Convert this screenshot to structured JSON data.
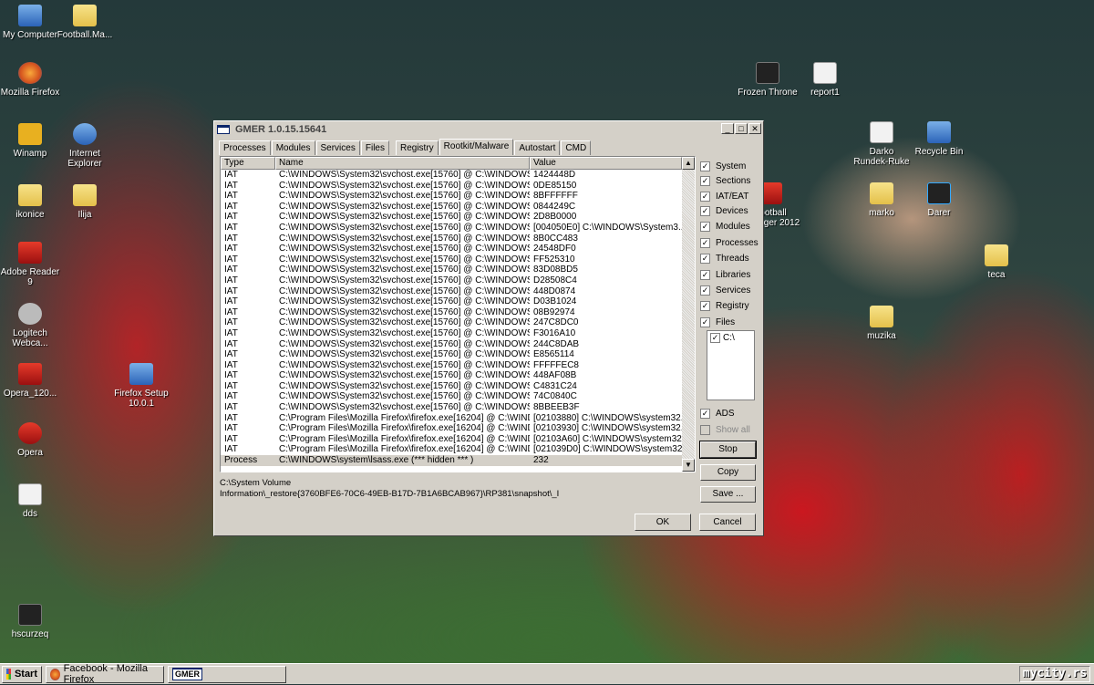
{
  "desktop": {
    "icons": [
      {
        "label": "My Computer"
      },
      {
        "label": "Football.Ma..."
      },
      {
        "label": "Mozilla Firefox"
      },
      {
        "label": "Winamp"
      },
      {
        "label": "Internet Explorer"
      },
      {
        "label": "ikonice"
      },
      {
        "label": "Ilija"
      },
      {
        "label": "Adobe Reader 9"
      },
      {
        "label": "Logitech Webca..."
      },
      {
        "label": "Opera_120..."
      },
      {
        "label": "Firefox Setup 10.0.1"
      },
      {
        "label": "Opera"
      },
      {
        "label": "dds"
      },
      {
        "label": "hscurzeq"
      },
      {
        "label": "Frozen Throne"
      },
      {
        "label": "report1"
      },
      {
        "label": "Darko Rundek-Ruke"
      },
      {
        "label": "Recycle Bin"
      },
      {
        "label": "Football Manager 2012"
      },
      {
        "label": "marko"
      },
      {
        "label": "Darer"
      },
      {
        "label": "teca"
      },
      {
        "label": "muzika"
      }
    ]
  },
  "window": {
    "title": "GMER 1.0.15.15641",
    "tabs": [
      "Processes",
      "Modules",
      "Services",
      "Files",
      "Registry",
      "Rootkit/Malware",
      "Autostart",
      "CMD"
    ],
    "active_tab": "Rootkit/Malware",
    "columns": [
      "Type",
      "Name",
      "Value"
    ],
    "rows": [
      [
        "IAT",
        "C:\\WINDOWS\\System32\\svchost.exe[15760] @ C:\\WINDOWS\\...",
        "1424448D"
      ],
      [
        "IAT",
        "C:\\WINDOWS\\System32\\svchost.exe[15760] @ C:\\WINDOWS\\...",
        "0DE85150"
      ],
      [
        "IAT",
        "C:\\WINDOWS\\System32\\svchost.exe[15760] @ C:\\WINDOWS\\...",
        "8BFFFFFF"
      ],
      [
        "IAT",
        "C:\\WINDOWS\\System32\\svchost.exe[15760] @ C:\\WINDOWS\\...",
        "0844249C"
      ],
      [
        "IAT",
        "C:\\WINDOWS\\System32\\svchost.exe[15760] @ C:\\WINDOWS\\...",
        "2D8B0000"
      ],
      [
        "IAT",
        "C:\\WINDOWS\\System32\\svchost.exe[15760] @ C:\\WINDOWS\\...",
        "[004050E0] C:\\WINDOWS\\System3..."
      ],
      [
        "IAT",
        "C:\\WINDOWS\\System32\\svchost.exe[15760] @ C:\\WINDOWS\\...",
        "8B0CC483"
      ],
      [
        "IAT",
        "C:\\WINDOWS\\System32\\svchost.exe[15760] @ C:\\WINDOWS\\...",
        "24548DF0"
      ],
      [
        "IAT",
        "C:\\WINDOWS\\System32\\svchost.exe[15760] @ C:\\WINDOWS\\...",
        "FF525310"
      ],
      [
        "IAT",
        "C:\\WINDOWS\\System32\\svchost.exe[15760] @ C:\\WINDOWS\\...",
        "83D08BD5"
      ],
      [
        "IAT",
        "C:\\WINDOWS\\System32\\svchost.exe[15760] @ C:\\WINDOWS\\...",
        "D28508C4"
      ],
      [
        "IAT",
        "C:\\WINDOWS\\System32\\svchost.exe[15760] @ C:\\WINDOWS\\...",
        "448D0874"
      ],
      [
        "IAT",
        "C:\\WINDOWS\\System32\\svchost.exe[15760] @ C:\\WINDOWS\\...",
        "D03B1024"
      ],
      [
        "IAT",
        "C:\\WINDOWS\\System32\\svchost.exe[15760] @ C:\\WINDOWS\\...",
        "08B92974"
      ],
      [
        "IAT",
        "C:\\WINDOWS\\System32\\svchost.exe[15760] @ C:\\WINDOWS\\...",
        "247C8DC0"
      ],
      [
        "IAT",
        "C:\\WINDOWS\\System32\\svchost.exe[15760] @ C:\\WINDOWS\\...",
        "F3016A10"
      ],
      [
        "IAT",
        "C:\\WINDOWS\\System32\\svchost.exe[15760] @ C:\\WINDOWS\\...",
        "244C8DAB"
      ],
      [
        "IAT",
        "C:\\WINDOWS\\System32\\svchost.exe[15760] @ C:\\WINDOWS\\...",
        "E8565114"
      ],
      [
        "IAT",
        "C:\\WINDOWS\\System32\\svchost.exe[15760] @ C:\\WINDOWS\\...",
        "FFFFFEC8"
      ],
      [
        "IAT",
        "C:\\WINDOWS\\System32\\svchost.exe[15760] @ C:\\WINDOWS\\...",
        "448AF08B"
      ],
      [
        "IAT",
        "C:\\WINDOWS\\System32\\svchost.exe[15760] @ C:\\WINDOWS\\...",
        "C4831C24"
      ],
      [
        "IAT",
        "C:\\WINDOWS\\System32\\svchost.exe[15760] @ C:\\WINDOWS\\...",
        "74C0840C"
      ],
      [
        "IAT",
        "C:\\WINDOWS\\System32\\svchost.exe[15760] @ C:\\WINDOWS\\...",
        "8BBEEB3F"
      ],
      [
        "IAT",
        "C:\\Program Files\\Mozilla Firefox\\firefox.exe[16204] @ C:\\WINDO...",
        "[02103880] C:\\WINDOWS\\system32..."
      ],
      [
        "IAT",
        "C:\\Program Files\\Mozilla Firefox\\firefox.exe[16204] @ C:\\WINDO...",
        "[02103930] C:\\WINDOWS\\system32..."
      ],
      [
        "IAT",
        "C:\\Program Files\\Mozilla Firefox\\firefox.exe[16204] @ C:\\WINDO...",
        "[02103A60] C:\\WINDOWS\\system32..."
      ],
      [
        "IAT",
        "C:\\Program Files\\Mozilla Firefox\\firefox.exe[16204] @ C:\\WINDO...",
        "[021039D0] C:\\WINDOWS\\system32..."
      ],
      [
        "Process",
        "C:\\WINDOWS\\system\\lsass.exe (*** hidden *** )",
        "232"
      ]
    ],
    "checks": [
      {
        "label": "System",
        "checked": true
      },
      {
        "label": "Sections",
        "checked": true
      },
      {
        "label": "IAT/EAT",
        "checked": true
      },
      {
        "label": "Devices",
        "checked": true
      },
      {
        "label": "Modules",
        "checked": true
      },
      {
        "label": "Processes",
        "checked": true
      },
      {
        "label": "Threads",
        "checked": true
      },
      {
        "label": "Libraries",
        "checked": true
      },
      {
        "label": "Services",
        "checked": true
      },
      {
        "label": "Registry",
        "checked": true
      },
      {
        "label": "Files",
        "checked": true
      }
    ],
    "drive": "C:\\",
    "ads": "ADS",
    "show_all": "Show all",
    "stop": "Stop",
    "copy": "Copy",
    "save": "Save ...",
    "path_line1": "C:\\System Volume",
    "path_line2": "Information\\_restore{3760BFE6-70C6-49EB-B17D-7B1A6BCAB967}\\RP381\\snapshot\\_I",
    "ok": "OK",
    "cancel": "Cancel"
  },
  "taskbar": {
    "start": "Start",
    "items": [
      "Facebook - Mozilla Firefox",
      "GMER"
    ],
    "watermark": "mycity.rs"
  }
}
